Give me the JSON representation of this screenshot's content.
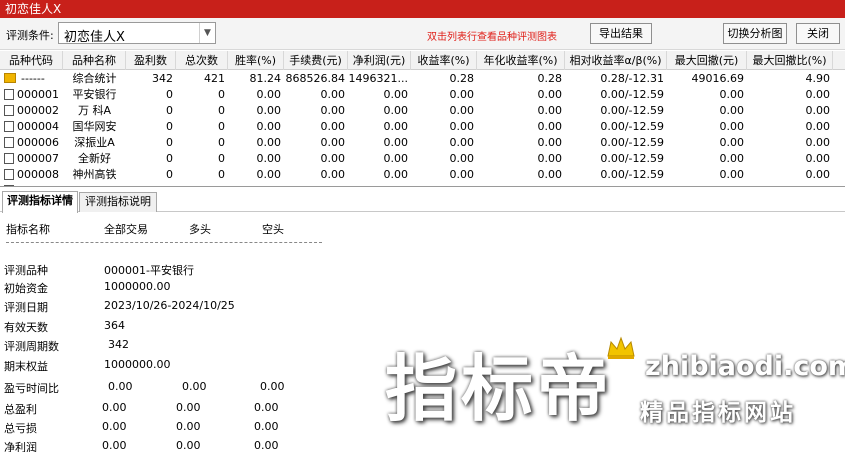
{
  "window": {
    "title": "初恋佳人X"
  },
  "toolbar": {
    "label": "评测条件:",
    "combo_value": "初恋佳人X",
    "hint": "双击列表行查看品种评测图表",
    "export_label": "导出结果",
    "switch_label": "切换分析图",
    "close_label": "关闭"
  },
  "table": {
    "headers": [
      "品种代码",
      "品种名称",
      "盈利数",
      "总次数",
      "胜率(%)",
      "手续费(元)",
      "净利润(元)",
      "收益率(%)",
      "年化收益率(%)",
      "相对收益率α/β(%)",
      "最大回撤(元)",
      "最大回撤比(%)"
    ],
    "summary": {
      "code": "------",
      "name": "综合统计",
      "cells": [
        "342",
        "421",
        "81.24",
        "868526.84",
        "1496321...",
        "0.28",
        "0.28",
        "0.28/-12.31",
        "49016.69",
        "4.90"
      ]
    },
    "rows": [
      {
        "code": "000001",
        "name": "平安银行",
        "cells": [
          "0",
          "0",
          "0.00",
          "0.00",
          "0.00",
          "0.00",
          "0.00",
          "0.00/-12.59",
          "0.00",
          "0.00"
        ]
      },
      {
        "code": "000002",
        "name": "万 科A",
        "cells": [
          "0",
          "0",
          "0.00",
          "0.00",
          "0.00",
          "0.00",
          "0.00",
          "0.00/-12.59",
          "0.00",
          "0.00"
        ]
      },
      {
        "code": "000004",
        "name": "国华网安",
        "cells": [
          "0",
          "0",
          "0.00",
          "0.00",
          "0.00",
          "0.00",
          "0.00",
          "0.00/-12.59",
          "0.00",
          "0.00"
        ]
      },
      {
        "code": "000006",
        "name": "深振业A",
        "cells": [
          "0",
          "0",
          "0.00",
          "0.00",
          "0.00",
          "0.00",
          "0.00",
          "0.00/-12.59",
          "0.00",
          "0.00"
        ]
      },
      {
        "code": "000007",
        "name": "全新好",
        "cells": [
          "0",
          "0",
          "0.00",
          "0.00",
          "0.00",
          "0.00",
          "0.00",
          "0.00/-12.59",
          "0.00",
          "0.00"
        ]
      },
      {
        "code": "000008",
        "name": "神州高铁",
        "cells": [
          "0",
          "0",
          "0.00",
          "0.00",
          "0.00",
          "0.00",
          "0.00",
          "0.00/-12.59",
          "0.00",
          "0.00"
        ]
      }
    ]
  },
  "tabs": [
    "评测指标详情",
    "评测指标说明"
  ],
  "detail": {
    "headers": [
      "指标名称",
      "全部交易",
      "多头",
      "空头"
    ],
    "info": [
      {
        "label": "评测品种",
        "value": "000001-平安银行"
      },
      {
        "label": "初始资金",
        "value": "1000000.00"
      },
      {
        "label": "评测日期",
        "value": "2023/10/26-2024/10/25"
      },
      {
        "label": "有效天数",
        "value": "364"
      },
      {
        "label": "评测周期数",
        "value": "342"
      },
      {
        "label": "期末权益",
        "value": "1000000.00"
      }
    ],
    "metrics": [
      {
        "label": "盈亏时间比",
        "values": [
          "0.00",
          "0.00",
          "0.00"
        ]
      },
      {
        "label": "总盈利",
        "values": [
          "0.00",
          "0.00",
          "0.00"
        ]
      },
      {
        "label": "总亏损",
        "values": [
          "0.00",
          "0.00",
          "0.00"
        ]
      },
      {
        "label": "净利润",
        "values": [
          "0.00",
          "0.00",
          "0.00"
        ]
      }
    ]
  },
  "watermark": {
    "main": "指标帝",
    "url": "zhibiaodi.com",
    "tagline": "精品指标网站"
  },
  "colors": {
    "titlebar": "#c8201a",
    "hint": "#e0201a",
    "crown": "#f2c400"
  }
}
